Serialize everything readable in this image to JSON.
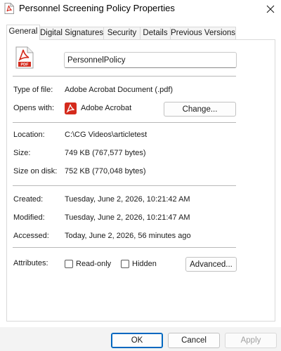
{
  "window": {
    "title": "Personnel Screening Policy Properties",
    "close_icon": "close-icon"
  },
  "tabs": [
    {
      "label": "General",
      "active": true
    },
    {
      "label": "Digital Signatures",
      "active": false
    },
    {
      "label": "Security",
      "active": false
    },
    {
      "label": "Details",
      "active": false
    },
    {
      "label": "Previous Versions",
      "active": false
    }
  ],
  "general": {
    "file_icon": "pdf-file-icon",
    "file_icon_text": "PDF",
    "file_name": "PersonnelPolicy",
    "type_label": "Type of file:",
    "type_value": "Adobe Acrobat Document (.pdf)",
    "opens_label": "Opens with:",
    "opens_app_icon": "acrobat-icon",
    "opens_value": "Adobe Acrobat",
    "change_button": "Change...",
    "location_label": "Location:",
    "location_value": "C:\\CG Videos\\articletest",
    "size_label": "Size:",
    "size_value": "749 KB (767,577 bytes)",
    "size_on_disk_label": "Size on disk:",
    "size_on_disk_value": "752 KB (770,048 bytes)",
    "created_label": "Created:",
    "created_value": "Tuesday, June 2, 2026, 10:21:42 AM",
    "modified_label": "Modified:",
    "modified_value": "Tuesday, June 2, 2026, 10:21:47 AM",
    "accessed_label": "Accessed:",
    "accessed_value": "Today, June 2, 2026, 56 minutes ago",
    "attributes_label": "Attributes:",
    "readonly_label": "Read-only",
    "readonly_checked": false,
    "hidden_label": "Hidden",
    "hidden_checked": false,
    "advanced_button": "Advanced..."
  },
  "footer": {
    "ok": "OK",
    "cancel": "Cancel",
    "apply": "Apply"
  },
  "colors": {
    "accent": "#0067c0",
    "pdf_red": "#d42a1c"
  }
}
